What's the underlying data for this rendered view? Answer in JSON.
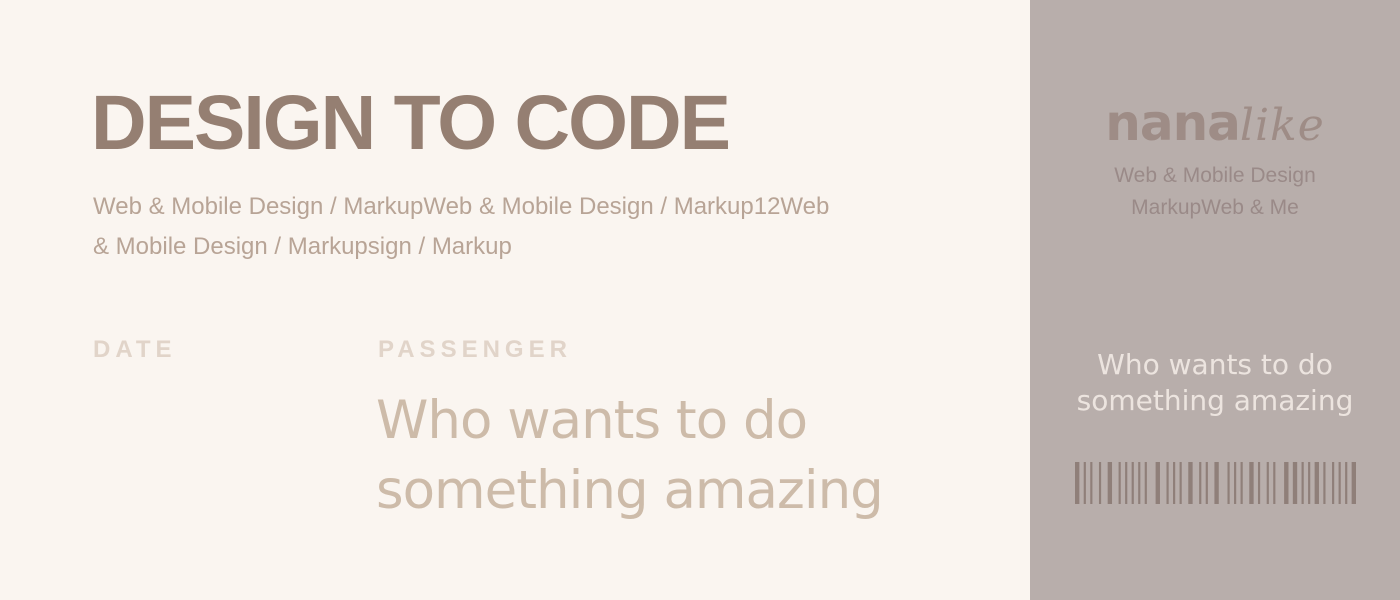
{
  "ticket": {
    "title": "DESIGN TO CODE",
    "subtitle": "Web & Mobile Design / MarkupWeb & Mobile Design / Markup12Web & Mobile Design / Markupsign / Markup",
    "date_label": "DATE",
    "passenger_label": "PASSENGER",
    "passenger_text": "Who wants to do something amazing"
  },
  "stub": {
    "brand_main": "nana",
    "brand_accent": "like",
    "sub_line_1": "Web & Mobile Design",
    "sub_line_2": "MarkupWeb & Me",
    "text_line_1": "Who wants to do",
    "text_line_2": "something amazing"
  },
  "colors": {
    "background": "#faf5f0",
    "stub_background": "#b8aeab",
    "title": "#957f72",
    "barcode": "#8f7f79"
  },
  "barcode_pattern": [
    2,
    2,
    1,
    2,
    1,
    3,
    1,
    3,
    2,
    3,
    1,
    2,
    1,
    2,
    1,
    2,
    1,
    2,
    1,
    4,
    2,
    3,
    1,
    2,
    1,
    2,
    1,
    3,
    2,
    3,
    1,
    2,
    1,
    3,
    2,
    4,
    1,
    2,
    1,
    2,
    1,
    3,
    2,
    2,
    1,
    3,
    1,
    2,
    1,
    4,
    2,
    2,
    2,
    2,
    1,
    2,
    1,
    2,
    2,
    2,
    1,
    3,
    1,
    2,
    1,
    2,
    1,
    2,
    2
  ]
}
